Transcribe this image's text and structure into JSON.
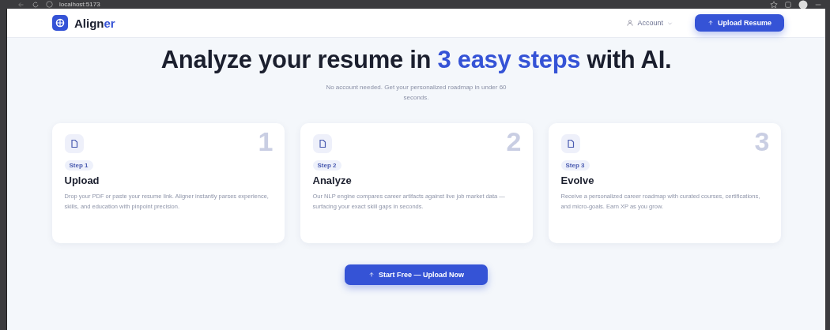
{
  "browser": {
    "url": "localhost:5173"
  },
  "header": {
    "brand": {
      "main": "Align",
      "accent": "er"
    },
    "account": {
      "label": "Account"
    },
    "upload_button": {
      "label": "Upload Resume"
    }
  },
  "hero": {
    "headline": {
      "before": "Analyze your resume in ",
      "accent": "3 easy steps",
      "after": " with AI."
    },
    "subtitle": "No account needed. Get your personalized roadmap in under 60 seconds."
  },
  "steps": [
    {
      "number": "1",
      "badge": "Step 1",
      "title": "Upload",
      "text": "Drop your PDF or paste your resume link. Aligner instantly parses experience, skills, and education with pinpoint precision."
    },
    {
      "number": "2",
      "badge": "Step 2",
      "title": "Analyze",
      "text": "Our NLP engine compares career artifacts against live job market data — surfacing your exact skill gaps in seconds."
    },
    {
      "number": "3",
      "badge": "Step 3",
      "title": "Evolve",
      "text": "Receive a personalized career roadmap with curated courses, certifications, and micro-goals. Earn XP as you grow."
    }
  ],
  "cta": {
    "label": "Start Free — Upload Now"
  }
}
